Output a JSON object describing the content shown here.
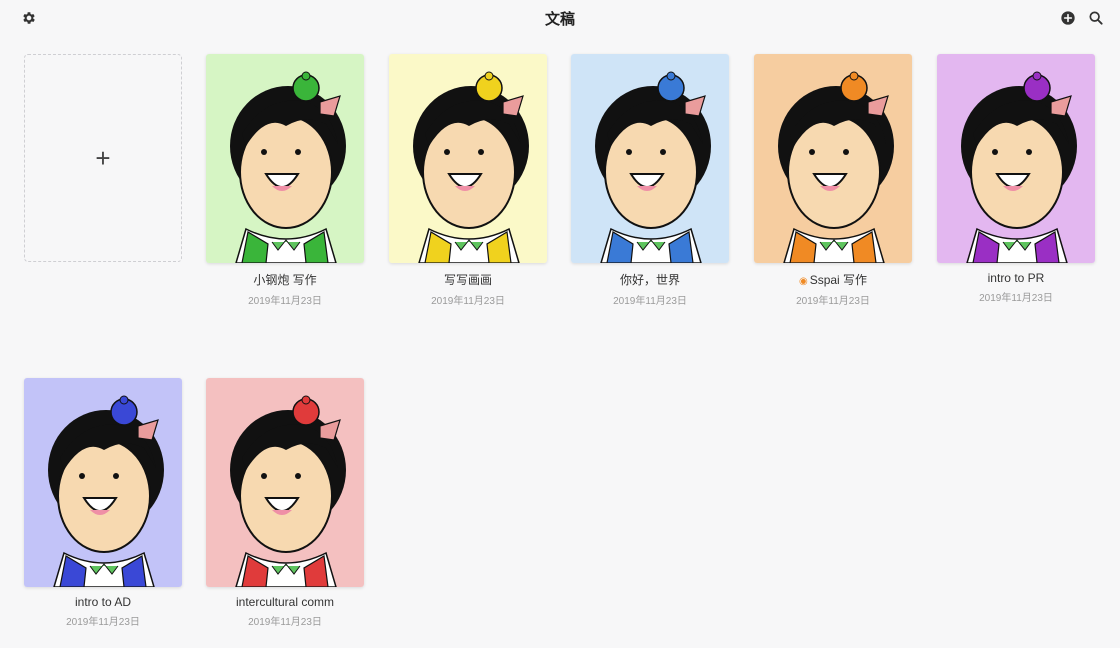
{
  "header": {
    "title": "文稿",
    "settings_icon": "gear-icon",
    "add_icon": "plus-circle-icon",
    "search_icon": "search-icon"
  },
  "new_document": {
    "label": "+"
  },
  "documents": [
    {
      "title": "小钢炮 写作",
      "date": "2019年11月23日",
      "bg": "#d6f5c4",
      "accent": "#3ab53a"
    },
    {
      "title": "写写画画",
      "date": "2019年11月23日",
      "bg": "#fbf9c8",
      "accent": "#f0d21e"
    },
    {
      "title": "你好，世界",
      "date": "2019年11月23日",
      "bg": "#cfe4f7",
      "accent": "#3a7ad6"
    },
    {
      "title": "Sspai 写作",
      "badge_icon": "eye-icon",
      "date": "2019年11月23日",
      "bg": "#f6cda0",
      "accent": "#f08a24"
    },
    {
      "title": "intro to PR",
      "date": "2019年11月23日",
      "bg": "#e3b7f0",
      "accent": "#9a2fc4"
    },
    {
      "title": "intro to AD",
      "date": "2019年11月23日",
      "bg": "#c2c3f8",
      "accent": "#3a48d6"
    },
    {
      "title": "intercultural comm",
      "date": "2019年11月23日",
      "bg": "#f4c0c0",
      "accent": "#e03b3b"
    }
  ]
}
